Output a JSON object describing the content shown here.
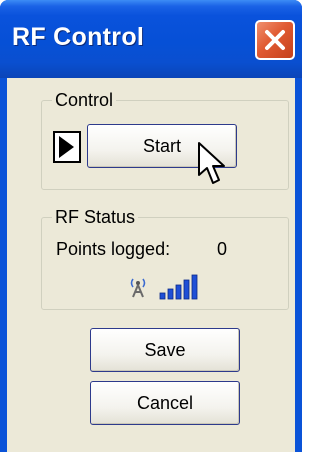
{
  "window": {
    "title": "RF Control"
  },
  "control_group": {
    "title": "Control",
    "start_label": "Start"
  },
  "status_group": {
    "title": "RF Status",
    "points_logged_label": "Points logged:",
    "points_logged_value": "0"
  },
  "buttons": {
    "save_label": "Save",
    "cancel_label": "Cancel"
  },
  "icons": {
    "close": "close-icon",
    "play": "play-icon",
    "antenna": "antenna-icon",
    "signal": "signal-strength-icon"
  },
  "colors": {
    "titlebar": "#0a52dc",
    "close_button": "#e05a32",
    "client_background": "#ece9d8",
    "signal_bars": "#1f4fd6"
  }
}
